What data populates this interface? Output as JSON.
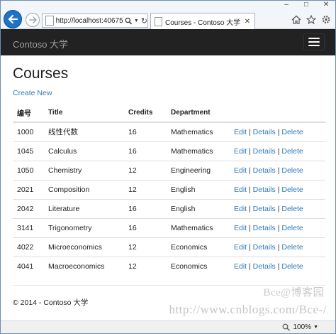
{
  "browser": {
    "address_url": "http://localhost:40675,",
    "tab_title": "Courses - Contoso 大学",
    "window_buttons": [
      "–",
      "□",
      "✕"
    ],
    "zoom": "100%"
  },
  "navbar": {
    "brand": "Contoso 大学"
  },
  "page": {
    "heading": "Courses",
    "create_link": "Create New"
  },
  "table": {
    "headers": [
      "编号",
      "Title",
      "Credits",
      "Department"
    ],
    "rows": [
      {
        "num": "1000",
        "title": "线性代数",
        "credits": "16",
        "dept": "Mathematics"
      },
      {
        "num": "1045",
        "title": "Calculus",
        "credits": "16",
        "dept": "Mathematics"
      },
      {
        "num": "1050",
        "title": "Chemistry",
        "credits": "12",
        "dept": "Engineering"
      },
      {
        "num": "2021",
        "title": "Composition",
        "credits": "12",
        "dept": "English"
      },
      {
        "num": "2042",
        "title": "Literature",
        "credits": "16",
        "dept": "English"
      },
      {
        "num": "3141",
        "title": "Trigonometry",
        "credits": "16",
        "dept": "Mathematics"
      },
      {
        "num": "4022",
        "title": "Microeconomics",
        "credits": "12",
        "dept": "Economics"
      },
      {
        "num": "4041",
        "title": "Macroeconomics",
        "credits": "12",
        "dept": "Economics"
      }
    ],
    "actions": {
      "edit": "Edit",
      "details": "Details",
      "delete": "Delete",
      "separator": "|"
    }
  },
  "footer": {
    "text": "© 2014 - Contoso 大学"
  },
  "watermark": {
    "line1": "Bce@博客园",
    "line2": "http://www.cnblogs.com/Bce-/"
  },
  "colors": {
    "link": "#337ab7",
    "navbar_bg": "#222222",
    "back_button": "#1c73c8"
  }
}
